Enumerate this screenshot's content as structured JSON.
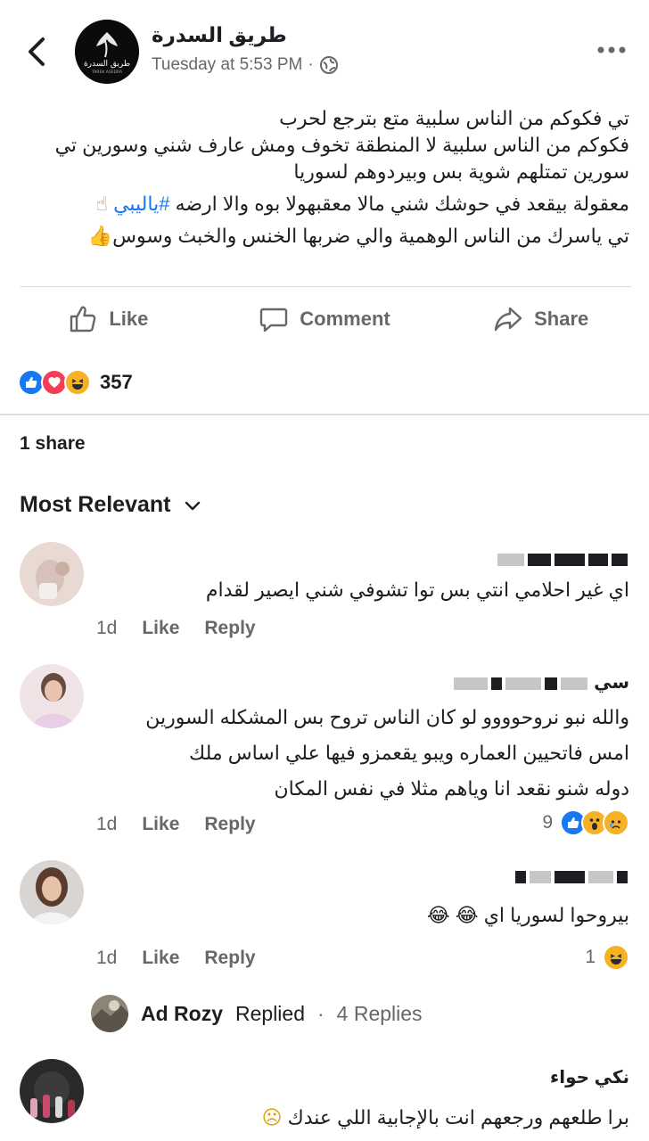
{
  "header": {
    "page_name": "طريق السدرة",
    "post_time": "Tuesday at 5:53 PM",
    "separator": "·",
    "logo_text": "طريق السدرة",
    "logo_subtext": "TAREK ASEDRA"
  },
  "post": {
    "lines": [
      "تي فكوكم من الناس سلبية متع بترجع لحرب",
      "فكوكم من الناس سلبية لا المنطقة تخوف ومش عارف شني وسورين تي",
      "سورين تمتلهم شوية بس وبيردوهم لسوريا",
      "معقولة بيقعد في حوشك شني مالا معقبهولا بوه والا ارضه",
      "تي ياسرك من الناس الوهمية والي ضربها الخنس والخبث وسوس"
    ],
    "hashtag": "#ياليبي",
    "emoji_point": "☝",
    "emoji_thumb": "👍"
  },
  "actions": {
    "like": "Like",
    "comment": "Comment",
    "share": "Share"
  },
  "reactions": {
    "count": "357"
  },
  "shares": "1 share",
  "sort": {
    "label": "Most Relevant"
  },
  "comments": [
    {
      "name_visible": "",
      "text": "اي غير احلامي انتي بس توا تشوفي شني ايصير لقدام",
      "time": "1d",
      "like": "Like",
      "reply": "Reply"
    },
    {
      "name_visible": "سي",
      "lines": [
        "والله نبو نروحوووو لو كان الناس تروح بس المشكله السورين",
        "امس فاتحيين العماره ويبو يقعمزو فيها علي اساس ملك",
        "دوله شنو نقعد انا وياهم مثلا في نفس المكان"
      ],
      "time": "1d",
      "like": "Like",
      "reply": "Reply",
      "reaction_count": "9"
    },
    {
      "name_visible": "",
      "text": "بيروحوا لسوريا اي",
      "emoji": "😂 😂",
      "time": "1d",
      "like": "Like",
      "reply": "Reply",
      "reaction_count": "1"
    },
    {
      "name_visible": "نكي حواء",
      "text": "برا طلعهم ورجعهم انت بالإجابية اللي عندك",
      "emoji": "☹"
    }
  ],
  "replies": {
    "who": "Ad Rozy",
    "verb": "Replied",
    "dot": "·",
    "count": "4 Replies"
  },
  "colors": {
    "accent": "#1877f2",
    "text": "#1c1e21",
    "muted": "#65676b",
    "divider": "#dadde1",
    "love": "#f33e58",
    "haha": "#f7b125"
  }
}
